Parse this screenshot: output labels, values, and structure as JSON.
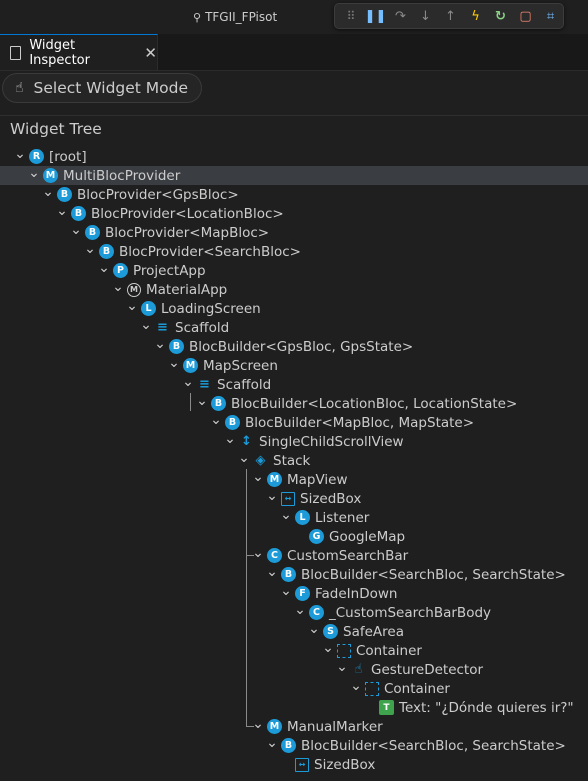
{
  "window": {
    "title": "TFGII_FPisot"
  },
  "debug_toolbar": {
    "icons": [
      "grip-icon",
      "pause-icon",
      "step-over-icon",
      "step-into-icon",
      "step-out-icon",
      "hot-reload-icon",
      "restart-icon",
      "stop-icon",
      "inspect-icon"
    ]
  },
  "tab": {
    "label": "Widget Inspector",
    "close": "✕"
  },
  "select_mode": {
    "label": "Select Widget Mode"
  },
  "panel": {
    "title": "Widget Tree"
  },
  "tree": [
    {
      "depth": 0,
      "icon": "R",
      "kind": "circle",
      "label": "[root]"
    },
    {
      "depth": 1,
      "icon": "M",
      "kind": "circle",
      "label": "MultiBlocProvider",
      "selected": true
    },
    {
      "depth": 2,
      "icon": "B",
      "kind": "circle",
      "label": "BlocProvider<GpsBloc>"
    },
    {
      "depth": 3,
      "icon": "B",
      "kind": "circle",
      "label": "BlocProvider<LocationBloc>"
    },
    {
      "depth": 4,
      "icon": "B",
      "kind": "circle",
      "label": "BlocProvider<MapBloc>"
    },
    {
      "depth": 5,
      "icon": "B",
      "kind": "circle",
      "label": "BlocProvider<SearchBloc>"
    },
    {
      "depth": 6,
      "icon": "P",
      "kind": "circle",
      "label": "ProjectApp"
    },
    {
      "depth": 7,
      "icon": "M",
      "kind": "mat",
      "label": "MaterialApp"
    },
    {
      "depth": 8,
      "icon": "L",
      "kind": "circle",
      "label": "LoadingScreen"
    },
    {
      "depth": 9,
      "icon": "≡",
      "kind": "plain",
      "label": "Scaffold"
    },
    {
      "depth": 10,
      "icon": "B",
      "kind": "circle",
      "label": "BlocBuilder<GpsBloc, GpsState>"
    },
    {
      "depth": 11,
      "icon": "M",
      "kind": "circle",
      "label": "MapScreen"
    },
    {
      "depth": 12,
      "icon": "≡",
      "kind": "plain",
      "label": "Scaffold"
    },
    {
      "depth": 13,
      "icon": "B",
      "kind": "circle",
      "label": "BlocBuilder<LocationBloc, LocationState>"
    },
    {
      "depth": 14,
      "icon": "B",
      "kind": "circle",
      "label": "BlocBuilder<MapBloc, MapState>"
    },
    {
      "depth": 15,
      "icon": "↕",
      "kind": "plain",
      "label": "SingleChildScrollView"
    },
    {
      "depth": 16,
      "icon": "◈",
      "kind": "plain",
      "label": "Stack"
    },
    {
      "depth": 17,
      "icon": "M",
      "kind": "circle",
      "label": "MapView"
    },
    {
      "depth": 18,
      "icon": "↔",
      "kind": "sq",
      "label": "SizedBox"
    },
    {
      "depth": 19,
      "icon": "L",
      "kind": "circle",
      "label": "Listener"
    },
    {
      "depth": 20,
      "icon": "G",
      "kind": "circle",
      "label": "GoogleMap",
      "leaf": true
    },
    {
      "depth": 17,
      "icon": "C",
      "kind": "circle",
      "label": "CustomSearchBar"
    },
    {
      "depth": 18,
      "icon": "B",
      "kind": "circle",
      "label": "BlocBuilder<SearchBloc, SearchState>"
    },
    {
      "depth": 19,
      "icon": "F",
      "kind": "circle",
      "label": "FadeInDown"
    },
    {
      "depth": 20,
      "icon": "C",
      "kind": "circle",
      "label": "_CustomSearchBarBody"
    },
    {
      "depth": 21,
      "icon": "S",
      "kind": "circle",
      "label": "SafeArea"
    },
    {
      "depth": 22,
      "icon": "",
      "kind": "dash",
      "label": "Container"
    },
    {
      "depth": 23,
      "icon": "☝",
      "kind": "plain",
      "label": "GestureDetector"
    },
    {
      "depth": 24,
      "icon": "",
      "kind": "dash",
      "label": "Container"
    },
    {
      "depth": 25,
      "icon": "T",
      "kind": "text",
      "label": "Text: \"¿Dónde quieres ir?\"",
      "leaf": true
    },
    {
      "depth": 17,
      "icon": "M",
      "kind": "circle",
      "label": "ManualMarker"
    },
    {
      "depth": 18,
      "icon": "B",
      "kind": "circle",
      "label": "BlocBuilder<SearchBloc, SearchState>"
    },
    {
      "depth": 19,
      "icon": "↔",
      "kind": "sq",
      "label": "SizedBox",
      "leaf": true
    }
  ],
  "colors": {
    "background": "#1f1f1f",
    "accent": "#1c9bd8",
    "selected_row": "#3a3d41",
    "text_node": "#3fa34d"
  }
}
